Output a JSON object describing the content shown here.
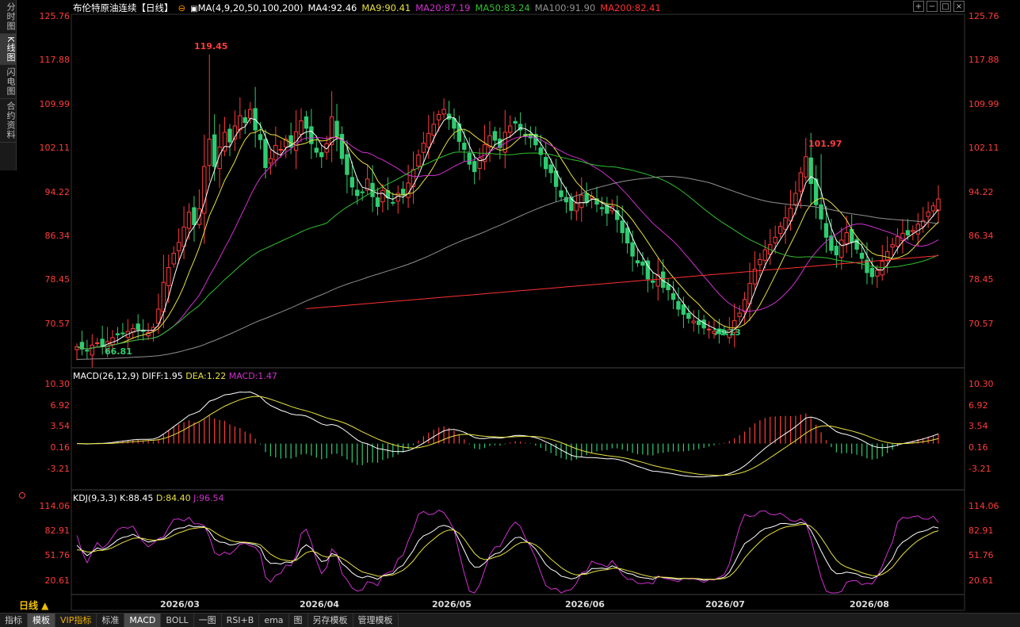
{
  "sidebar": {
    "tabs": [
      {
        "label": "分时图",
        "active": false
      },
      {
        "label": "K线图",
        "active": true
      },
      {
        "label": "闪电图",
        "active": false
      },
      {
        "label": "合约资料",
        "active": false
      }
    ]
  },
  "header": {
    "title": "布伦特原油连续【日线】",
    "title_icon": "minus-circle-icon",
    "ma_icon": "indicator-icon",
    "ma_params": "MA(4,9,20,50,100,200)",
    "ma4": "MA4:92.46",
    "ma9": "MA9:90.41",
    "ma20": "MA20:87.19",
    "ma50": "MA50:83.24",
    "ma100": "MA100:91.90",
    "ma200": "MA200:82.41"
  },
  "toolbar": {
    "icons": [
      "zoom-in-icon",
      "zoom-out-icon",
      "restore-icon",
      "close-icon"
    ]
  },
  "colors": {
    "up": "#ff3b3b",
    "down": "#2ecc71",
    "ma4": "#ffffff",
    "ma9": "#e8e040",
    "ma20": "#d030d0",
    "ma50": "#30c030",
    "ma100": "#909090",
    "ma200": "#ff3030",
    "grid": "#222"
  },
  "price_axis": [
    "125.76",
    "117.88",
    "109.99",
    "102.11",
    "94.22",
    "86.34",
    "78.45",
    "70.57"
  ],
  "price_labels": {
    "high1": "119.45",
    "low1": "66.81",
    "low2": "70.13",
    "high2": "101.97"
  },
  "macd": {
    "title": "MACD(26,12,9)",
    "diff": "DIFF:1.95",
    "dea": "DEA:1.22",
    "macd": "MACD:1.47",
    "axis": [
      "10.30",
      "6.92",
      "3.54",
      "0.16",
      "-3.21"
    ]
  },
  "kdj": {
    "title": "KDJ(9,3,3)",
    "k": "K:88.45",
    "d": "D:84.40",
    "j": "J:96.54",
    "axis": [
      "114.06",
      "82.91",
      "51.76",
      "20.61"
    ]
  },
  "x_axis": [
    "2026/03",
    "2026/04",
    "2026/05",
    "2026/06",
    "2026/07",
    "2026/08"
  ],
  "period_label": "日线 ▲",
  "bottom_tabs": [
    {
      "label": "指标",
      "active": false,
      "vip": false
    },
    {
      "label": "模板",
      "active": true,
      "vip": false
    },
    {
      "label": "VIP指标",
      "active": false,
      "vip": true
    },
    {
      "label": "标准",
      "active": false,
      "vip": false
    },
    {
      "label": "MACD",
      "active": true,
      "vip": false
    },
    {
      "label": "BOLL",
      "active": false,
      "vip": false
    },
    {
      "label": "一图",
      "active": false,
      "vip": false
    },
    {
      "label": "RSI+B",
      "active": false,
      "vip": false
    },
    {
      "label": "ema",
      "active": false,
      "vip": false
    },
    {
      "label": "图",
      "active": false,
      "vip": false
    },
    {
      "label": "另存模板",
      "active": false,
      "vip": false
    },
    {
      "label": "管理模板",
      "active": false,
      "vip": false
    }
  ],
  "chart_data": {
    "type": "candlestick",
    "close": [
      68.2,
      67.8,
      67.5,
      68.5,
      68.9,
      68.2,
      69.1,
      69.8,
      70.3,
      70.6,
      70.9,
      71.4,
      71.2,
      70.9,
      70.7,
      71.6,
      74.8,
      79.5,
      82.1,
      84.6,
      86.5,
      89.2,
      91.8,
      89.6,
      92.4,
      99.8,
      104.6,
      99.8,
      103.2,
      105.8,
      104.1,
      106.9,
      108.7,
      107.5,
      109.8,
      106.2,
      104.5,
      99.6,
      101.2,
      103.5,
      102.8,
      104.6,
      103.2,
      105.9,
      107.8,
      106.5,
      103.8,
      102.3,
      101.5,
      103.8,
      108.5,
      105.1,
      101.2,
      98.4,
      96.2,
      94.7,
      95.3,
      97.6,
      94.5,
      92.8,
      95.6,
      94.3,
      93.5,
      95.1,
      94.8,
      96.9,
      99.3,
      101.8,
      103.9,
      105.6,
      107.2,
      108.9,
      109.8,
      108.1,
      106.5,
      104.2,
      102.8,
      100.2,
      98.9,
      101.3,
      103.6,
      105.2,
      104.4,
      103.1,
      105.8,
      106.9,
      107.4,
      106.2,
      105.1,
      104.8,
      103.6,
      101.9,
      99.4,
      98.7,
      96.3,
      94.5,
      93.6,
      92.1,
      93.4,
      94.8,
      93.5,
      94.6,
      93.2,
      92.4,
      91.6,
      92.8,
      90.5,
      88.2,
      86.4,
      84.1,
      82.9,
      82.5,
      80.1,
      79.5,
      80.8,
      78.6,
      78.2,
      76.5,
      74.8,
      73.9,
      73.2,
      72.7,
      72.1,
      71.5,
      71.3,
      70.9,
      70.5,
      70.4,
      71.2,
      72.8,
      74.1,
      76.5,
      79.3,
      81.8,
      83.5,
      85.2,
      86.1,
      87.4,
      89.3,
      90.8,
      92.5,
      95.1,
      98.7,
      101.5,
      96.8,
      93.1,
      90.6,
      87.4,
      85.1,
      84.3,
      86.9,
      88.2,
      86.5,
      85.3,
      83.7,
      81.2,
      80.5,
      81.6,
      83.2,
      84.9,
      86.1,
      87.5,
      88.1,
      87.8,
      88.6,
      89.7,
      90.3,
      91.8,
      92.9,
      94.1
    ]
  }
}
